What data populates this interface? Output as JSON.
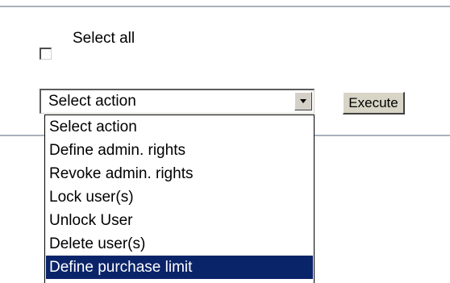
{
  "select_all": {
    "label": "Select all",
    "checked": false
  },
  "action_select": {
    "current_value": "Select action",
    "options": [
      "Select action",
      "Define admin. rights",
      "Revoke admin. rights",
      "Lock user(s)",
      "Unlock User",
      "Delete user(s)",
      "Define purchase limit"
    ],
    "highlighted_option": "Define purchase limit"
  },
  "execute_button": {
    "label": "Execute"
  },
  "colors": {
    "divider": "#a9b1bd",
    "highlight_bg": "#0a246a",
    "highlight_text": "#ffffff",
    "button_face": "#d8d4c6"
  },
  "icons": {
    "dropdown_arrow": "chevron-down-icon"
  }
}
